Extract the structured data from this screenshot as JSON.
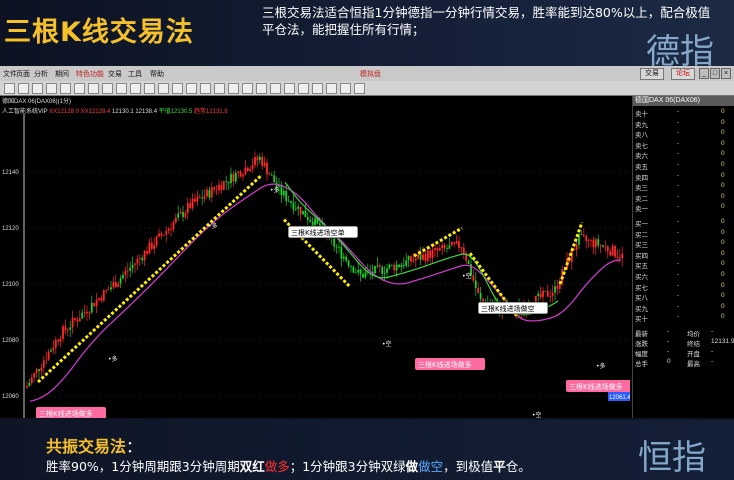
{
  "banner": {
    "title": "三根K线交易法",
    "description": "三根交易法适合恒指1分钟德指一分钟行情交易，胜率能到达80%以上，配合极值平仓法，能把握住所有行情；"
  },
  "watermarks": {
    "top": "德指",
    "bottom": "恒指"
  },
  "app": {
    "menu": [
      "文件",
      "页面",
      "分析",
      "期间",
      "特色功能",
      "交易",
      "工具",
      "帮助"
    ],
    "title": "模拟盘",
    "trade_button": "交易",
    "forum_button": "论坛",
    "instrument_label": "德国DAX 06(DAX06)(1分)",
    "indicator": {
      "name": "人工智能系统VIP",
      "values": [
        {
          "text": "XX12128.0",
          "color": "#ff3b3b"
        },
        {
          "text": "XX12128.4",
          "color": "#ff3b3b"
        },
        {
          "text": "12130.1",
          "color": "#dddddd"
        },
        {
          "text": "12138.4",
          "color": "#dddddd"
        },
        {
          "text": "平值12130.5",
          "color": "#33dd33"
        },
        {
          "text": "趋势12131.8",
          "color": "#ff3b3b"
        }
      ]
    }
  },
  "chart": {
    "y_ticks": [
      "12140",
      "12120",
      "12100",
      "12080",
      "12060"
    ],
    "price_tag": "12061.4",
    "annotations": {
      "buy_signal": "三根K线进场做多",
      "sell_signal": "三根K线进场空单",
      "buy_signal_2": "三根K线进场做多",
      "sell_signal_2": "三根K线进场做空",
      "buy_signal_3": "三根K线进场做多",
      "mark_long": "多",
      "mark_short": "空",
      "mark_long_top": "多",
      "mark_short_bottom": "空",
      "mark_short_bottom_2": "空",
      "mark_top_short": "空",
      "mark_long_2": "多",
      "mark_long_3": "多"
    }
  },
  "quote_panel": {
    "header": "德国DAX 06(DAX06)",
    "asks": [
      {
        "label": "卖十",
        "price": "-",
        "vol": "0"
      },
      {
        "label": "卖九",
        "price": "-",
        "vol": "0"
      },
      {
        "label": "卖八",
        "price": "-",
        "vol": "0"
      },
      {
        "label": "卖七",
        "price": "-",
        "vol": "0"
      },
      {
        "label": "卖六",
        "price": "-",
        "vol": "0"
      },
      {
        "label": "卖五",
        "price": "-",
        "vol": "0"
      },
      {
        "label": "卖四",
        "price": "-",
        "vol": "0"
      },
      {
        "label": "卖三",
        "price": "-",
        "vol": "0"
      },
      {
        "label": "卖二",
        "price": "-",
        "vol": "0"
      },
      {
        "label": "卖一",
        "price": "-",
        "vol": "0"
      }
    ],
    "bids": [
      {
        "label": "买一",
        "price": "-",
        "vol": "0"
      },
      {
        "label": "买二",
        "price": "-",
        "vol": "0"
      },
      {
        "label": "买三",
        "price": "-",
        "vol": "0"
      },
      {
        "label": "买四",
        "price": "-",
        "vol": "0"
      },
      {
        "label": "买五",
        "price": "-",
        "vol": "0"
      },
      {
        "label": "买六",
        "price": "-",
        "vol": "0"
      },
      {
        "label": "买七",
        "price": "-",
        "vol": "0"
      },
      {
        "label": "买八",
        "price": "-",
        "vol": "0"
      },
      {
        "label": "买九",
        "price": "-",
        "vol": "0"
      },
      {
        "label": "买十",
        "price": "-",
        "vol": "0"
      }
    ],
    "stats": [
      {
        "l1": "最新",
        "v1": "-",
        "l2": "均价",
        "v2": "-"
      },
      {
        "l1": "涨跌",
        "v1": "-",
        "l2": "终结",
        "v2": "12131.9"
      },
      {
        "l1": "幅度",
        "v1": "-",
        "l2": "开盘",
        "v2": "-"
      },
      {
        "l1": "总手",
        "v1": "0",
        "l2": "最高",
        "v2": "-"
      }
    ]
  },
  "bottom": {
    "title": "共振交易法",
    "colon": "：",
    "line_parts": {
      "p1": "胜率90%，1分钟周期跟3分钟周期",
      "p2": "双红",
      "p3": "做多",
      "p4": "；1分钟跟3分钟双绿",
      "p5": "做",
      "p6": "做空",
      "p7": "，到极值",
      "p8": "平",
      "p9": "仓。"
    }
  }
}
